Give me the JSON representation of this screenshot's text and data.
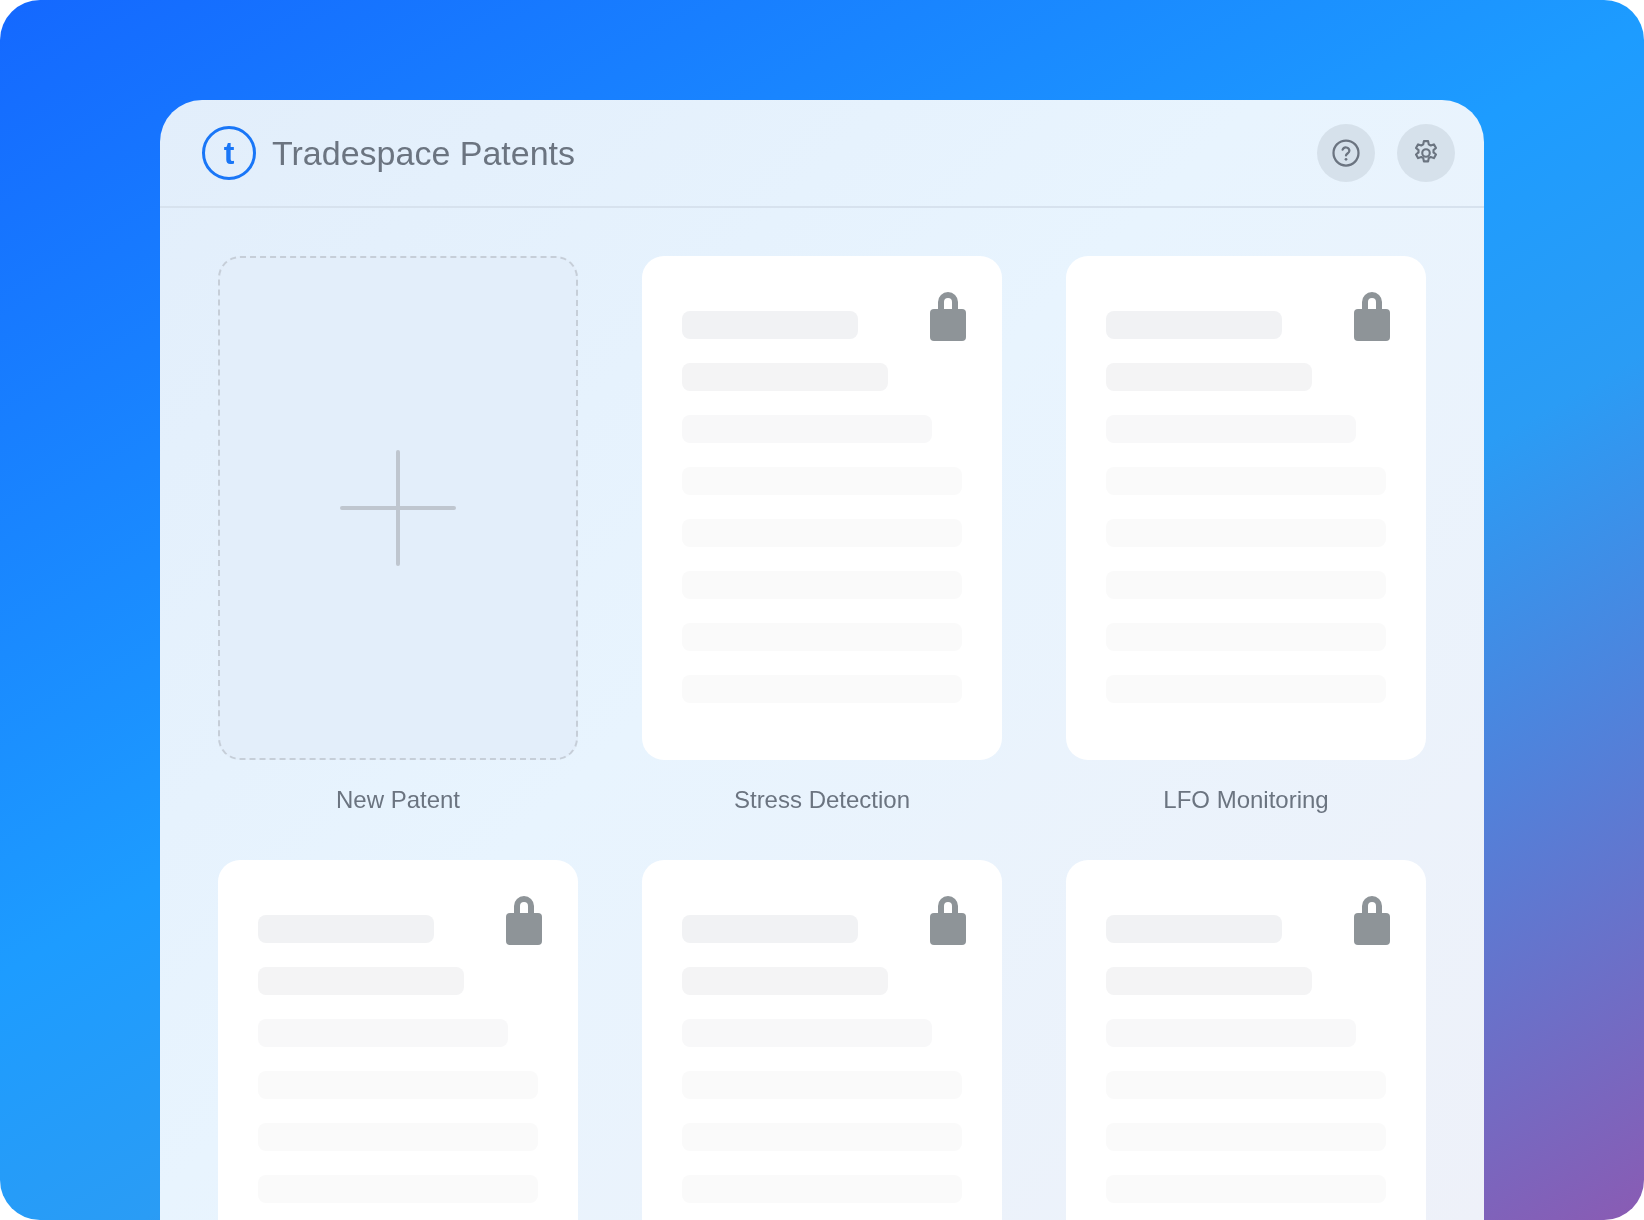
{
  "header": {
    "logo_letter": "t",
    "title": "Tradespace Patents"
  },
  "cards": [
    {
      "kind": "new",
      "label": "New Patent"
    },
    {
      "kind": "patent",
      "label": "Stress Detection",
      "locked": true
    },
    {
      "kind": "patent",
      "label": "LFO Monitoring",
      "locked": true
    },
    {
      "kind": "patent",
      "locked": true
    },
    {
      "kind": "patent",
      "locked": true
    },
    {
      "kind": "patent",
      "locked": true
    }
  ]
}
